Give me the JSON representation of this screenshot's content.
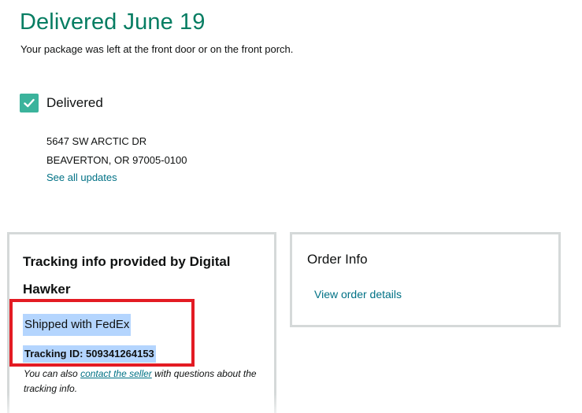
{
  "header": {
    "title": "Delivered June 19",
    "subtitle": "Your package was left at the front door or on the front porch."
  },
  "status": {
    "label": "Delivered",
    "icon": "checkmark-icon",
    "color": "#3bb39c"
  },
  "address": {
    "line1": "5647 SW ARCTIC DR",
    "line2": "BEAVERTON, OR 97005-0100"
  },
  "updates_link": "See all updates",
  "tracking_card": {
    "title": "Tracking info provided by Digital Hawker",
    "carrier": "Shipped with FedEx",
    "tracking_id": "Tracking ID: 509341264153",
    "note_prefix": "You can also ",
    "note_link": "contact the seller",
    "note_suffix": " with questions about the tracking info."
  },
  "order_card": {
    "title": "Order Info",
    "link": "View order details"
  },
  "colors": {
    "headline": "#067d62",
    "link": "#007185",
    "highlight": "#b4d5fe",
    "annotation_box": "#e31b23",
    "card_border": "#d5d9d9"
  }
}
